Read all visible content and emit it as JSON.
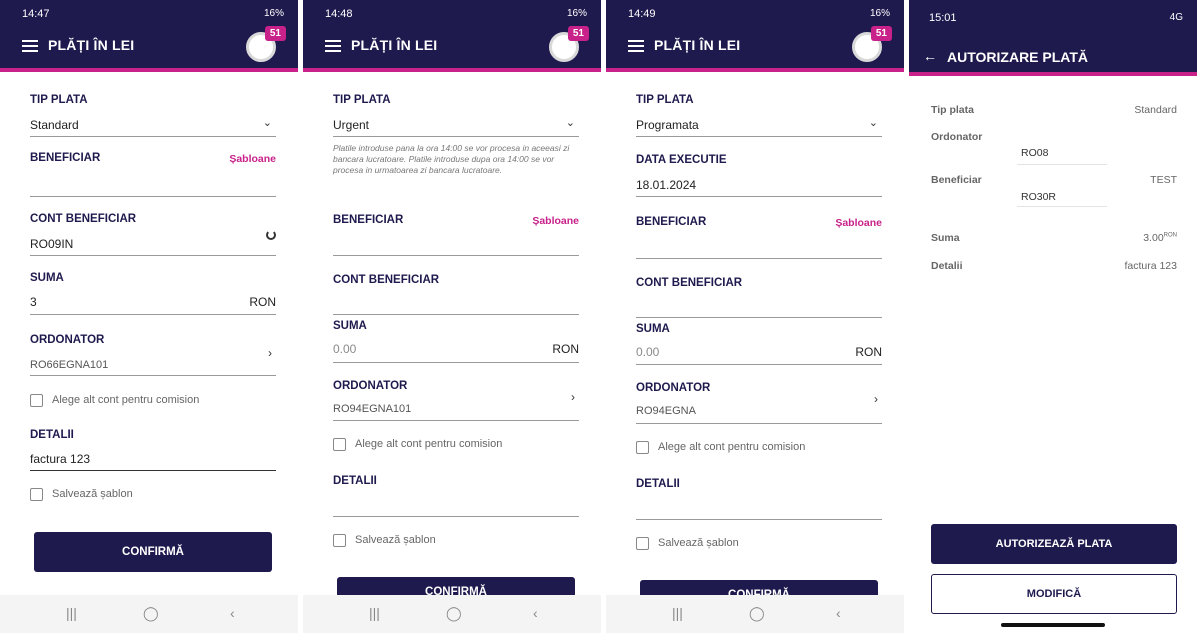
{
  "screens": [
    {
      "status_time": "14:47",
      "status_right": "16%",
      "title": "PLĂȚI ÎN LEI",
      "badge": "51",
      "tip_plata_label": "TIP PLATA",
      "tip_plata_value": "Standard",
      "beneficiar_label": "BENEFICIAR",
      "sabloane": "Șabloane",
      "cont_label": "CONT BENEFICIAR",
      "cont_value": "RO09IN",
      "suma_label": "SUMA",
      "suma_value": "3",
      "currency": "RON",
      "ordonator_label": "ORDONATOR",
      "ordonator_value": "RO66EGNA101",
      "comision_label": "Alege alt cont pentru comision",
      "detalii_label": "DETALII",
      "detalii_value": "factura 123",
      "sablon_label": "Salvează șablon",
      "confirm": "CONFIRMĂ"
    },
    {
      "status_time": "14:48",
      "status_right": "16%",
      "title": "PLĂȚI ÎN LEI",
      "badge": "51",
      "tip_plata_label": "TIP PLATA",
      "tip_plata_value": "Urgent",
      "note": "Platile introduse pana la ora 14:00 se vor procesa in aceeasi zi bancara lucratoare. Platile introduse dupa ora 14:00 se vor procesa in urmatoarea zi bancara lucratoare.",
      "beneficiar_label": "BENEFICIAR",
      "sabloane": "Șabloane",
      "cont_label": "CONT BENEFICIAR",
      "suma_label": "SUMA",
      "suma_placeholder": "0.00",
      "currency": "RON",
      "ordonator_label": "ORDONATOR",
      "ordonator_value": "RO94EGNA101",
      "comision_label": "Alege alt cont pentru comision",
      "detalii_label": "DETALII",
      "sablon_label": "Salvează șablon",
      "confirm": "CONFIRMĂ"
    },
    {
      "status_time": "14:49",
      "status_right": "16%",
      "title": "PLĂȚI ÎN LEI",
      "badge": "51",
      "tip_plata_label": "TIP PLATA",
      "tip_plata_value": "Programata",
      "data_label": "DATA EXECUTIE",
      "data_value": "18.01.2024",
      "beneficiar_label": "BENEFICIAR",
      "sabloane": "Șabloane",
      "cont_label": "CONT BENEFICIAR",
      "suma_label": "SUMA",
      "suma_placeholder": "0.00",
      "currency": "RON",
      "ordonator_label": "ORDONATOR",
      "ordonator_value": "RO94EGNA",
      "comision_label": "Alege alt cont pentru comision",
      "detalii_label": "DETALII",
      "sablon_label": "Salvează șablon",
      "confirm": "CONFIRMĂ"
    },
    {
      "status_time": "15:01",
      "status_right": "4G",
      "title": "AUTORIZARE PLATĂ",
      "rows": {
        "tip_label": "Tip plata",
        "tip_value": "Standard",
        "ordonator_label": "Ordonator",
        "ordonator_value": "RO08",
        "beneficiar_label": "Beneficiar",
        "beneficiar_name": "TEST",
        "beneficiar_iban": "RO30R",
        "suma_label": "Suma",
        "suma_value": "3.00",
        "suma_currency": "RON",
        "detalii_label": "Detalii",
        "detalii_value": "factura 123"
      },
      "authorize": "AUTORIZEAZĂ PLATA",
      "modify": "MODIFICĂ"
    }
  ],
  "navbar": {
    "recents": "|||",
    "home": "◯",
    "back": "‹"
  }
}
